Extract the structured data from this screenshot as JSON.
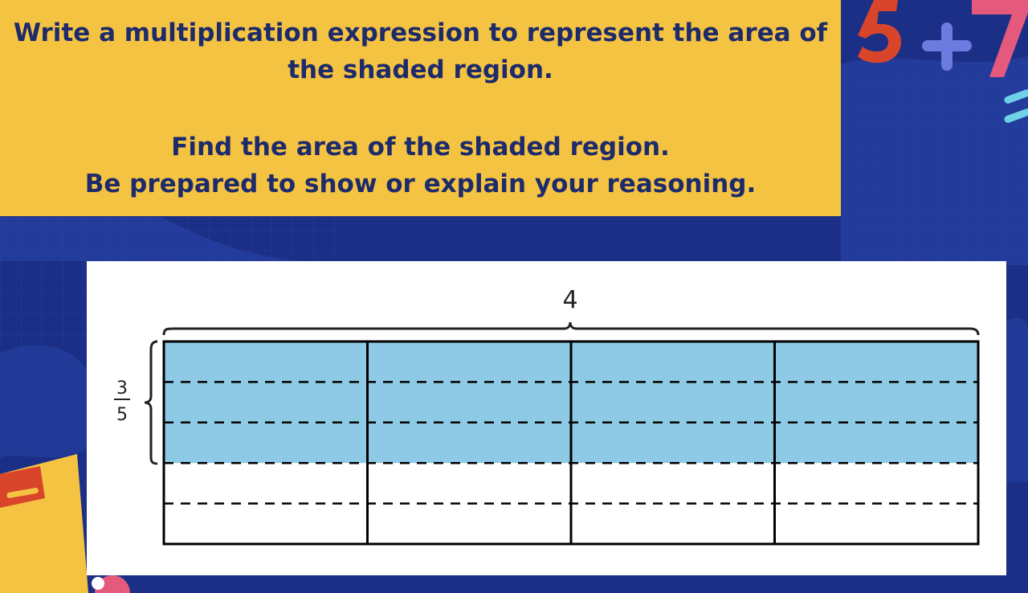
{
  "prompt": {
    "line1": "Write a multiplication expression to represent the area of",
    "line2": "the shaded region.",
    "line3": "Find the area of the shaded region.",
    "line4": "Be prepared to show or explain your reasoning."
  },
  "diagram": {
    "width_label": "4",
    "height_label_numerator": "3",
    "height_label_denominator": "5",
    "columns": 4,
    "rows": 5,
    "shaded_rows": 3,
    "shade_color": "#8ecae6",
    "line_color": "#000000"
  },
  "decorations": {
    "corner_numbers": "5+7"
  },
  "colors": {
    "background": "#1b2f86",
    "prompt_bg": "#f5c342",
    "prompt_text": "#1d2b6b"
  }
}
